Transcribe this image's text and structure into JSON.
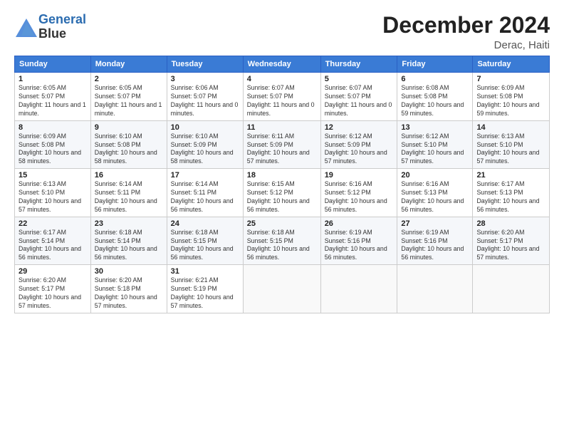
{
  "header": {
    "logo_line1": "General",
    "logo_line2": "Blue",
    "title": "December 2024",
    "subtitle": "Derac, Haiti"
  },
  "weekdays": [
    "Sunday",
    "Monday",
    "Tuesday",
    "Wednesday",
    "Thursday",
    "Friday",
    "Saturday"
  ],
  "weeks": [
    [
      {
        "day": "1",
        "sunrise": "Sunrise: 6:05 AM",
        "sunset": "Sunset: 5:07 PM",
        "daylight": "Daylight: 11 hours and 1 minute."
      },
      {
        "day": "2",
        "sunrise": "Sunrise: 6:05 AM",
        "sunset": "Sunset: 5:07 PM",
        "daylight": "Daylight: 11 hours and 1 minute."
      },
      {
        "day": "3",
        "sunrise": "Sunrise: 6:06 AM",
        "sunset": "Sunset: 5:07 PM",
        "daylight": "Daylight: 11 hours and 0 minutes."
      },
      {
        "day": "4",
        "sunrise": "Sunrise: 6:07 AM",
        "sunset": "Sunset: 5:07 PM",
        "daylight": "Daylight: 11 hours and 0 minutes."
      },
      {
        "day": "5",
        "sunrise": "Sunrise: 6:07 AM",
        "sunset": "Sunset: 5:07 PM",
        "daylight": "Daylight: 11 hours and 0 minutes."
      },
      {
        "day": "6",
        "sunrise": "Sunrise: 6:08 AM",
        "sunset": "Sunset: 5:08 PM",
        "daylight": "Daylight: 10 hours and 59 minutes."
      },
      {
        "day": "7",
        "sunrise": "Sunrise: 6:09 AM",
        "sunset": "Sunset: 5:08 PM",
        "daylight": "Daylight: 10 hours and 59 minutes."
      }
    ],
    [
      {
        "day": "8",
        "sunrise": "Sunrise: 6:09 AM",
        "sunset": "Sunset: 5:08 PM",
        "daylight": "Daylight: 10 hours and 58 minutes."
      },
      {
        "day": "9",
        "sunrise": "Sunrise: 6:10 AM",
        "sunset": "Sunset: 5:08 PM",
        "daylight": "Daylight: 10 hours and 58 minutes."
      },
      {
        "day": "10",
        "sunrise": "Sunrise: 6:10 AM",
        "sunset": "Sunset: 5:09 PM",
        "daylight": "Daylight: 10 hours and 58 minutes."
      },
      {
        "day": "11",
        "sunrise": "Sunrise: 6:11 AM",
        "sunset": "Sunset: 5:09 PM",
        "daylight": "Daylight: 10 hours and 57 minutes."
      },
      {
        "day": "12",
        "sunrise": "Sunrise: 6:12 AM",
        "sunset": "Sunset: 5:09 PM",
        "daylight": "Daylight: 10 hours and 57 minutes."
      },
      {
        "day": "13",
        "sunrise": "Sunrise: 6:12 AM",
        "sunset": "Sunset: 5:10 PM",
        "daylight": "Daylight: 10 hours and 57 minutes."
      },
      {
        "day": "14",
        "sunrise": "Sunrise: 6:13 AM",
        "sunset": "Sunset: 5:10 PM",
        "daylight": "Daylight: 10 hours and 57 minutes."
      }
    ],
    [
      {
        "day": "15",
        "sunrise": "Sunrise: 6:13 AM",
        "sunset": "Sunset: 5:10 PM",
        "daylight": "Daylight: 10 hours and 57 minutes."
      },
      {
        "day": "16",
        "sunrise": "Sunrise: 6:14 AM",
        "sunset": "Sunset: 5:11 PM",
        "daylight": "Daylight: 10 hours and 56 minutes."
      },
      {
        "day": "17",
        "sunrise": "Sunrise: 6:14 AM",
        "sunset": "Sunset: 5:11 PM",
        "daylight": "Daylight: 10 hours and 56 minutes."
      },
      {
        "day": "18",
        "sunrise": "Sunrise: 6:15 AM",
        "sunset": "Sunset: 5:12 PM",
        "daylight": "Daylight: 10 hours and 56 minutes."
      },
      {
        "day": "19",
        "sunrise": "Sunrise: 6:16 AM",
        "sunset": "Sunset: 5:12 PM",
        "daylight": "Daylight: 10 hours and 56 minutes."
      },
      {
        "day": "20",
        "sunrise": "Sunrise: 6:16 AM",
        "sunset": "Sunset: 5:13 PM",
        "daylight": "Daylight: 10 hours and 56 minutes."
      },
      {
        "day": "21",
        "sunrise": "Sunrise: 6:17 AM",
        "sunset": "Sunset: 5:13 PM",
        "daylight": "Daylight: 10 hours and 56 minutes."
      }
    ],
    [
      {
        "day": "22",
        "sunrise": "Sunrise: 6:17 AM",
        "sunset": "Sunset: 5:14 PM",
        "daylight": "Daylight: 10 hours and 56 minutes."
      },
      {
        "day": "23",
        "sunrise": "Sunrise: 6:18 AM",
        "sunset": "Sunset: 5:14 PM",
        "daylight": "Daylight: 10 hours and 56 minutes."
      },
      {
        "day": "24",
        "sunrise": "Sunrise: 6:18 AM",
        "sunset": "Sunset: 5:15 PM",
        "daylight": "Daylight: 10 hours and 56 minutes."
      },
      {
        "day": "25",
        "sunrise": "Sunrise: 6:18 AM",
        "sunset": "Sunset: 5:15 PM",
        "daylight": "Daylight: 10 hours and 56 minutes."
      },
      {
        "day": "26",
        "sunrise": "Sunrise: 6:19 AM",
        "sunset": "Sunset: 5:16 PM",
        "daylight": "Daylight: 10 hours and 56 minutes."
      },
      {
        "day": "27",
        "sunrise": "Sunrise: 6:19 AM",
        "sunset": "Sunset: 5:16 PM",
        "daylight": "Daylight: 10 hours and 56 minutes."
      },
      {
        "day": "28",
        "sunrise": "Sunrise: 6:20 AM",
        "sunset": "Sunset: 5:17 PM",
        "daylight": "Daylight: 10 hours and 57 minutes."
      }
    ],
    [
      {
        "day": "29",
        "sunrise": "Sunrise: 6:20 AM",
        "sunset": "Sunset: 5:17 PM",
        "daylight": "Daylight: 10 hours and 57 minutes."
      },
      {
        "day": "30",
        "sunrise": "Sunrise: 6:20 AM",
        "sunset": "Sunset: 5:18 PM",
        "daylight": "Daylight: 10 hours and 57 minutes."
      },
      {
        "day": "31",
        "sunrise": "Sunrise: 6:21 AM",
        "sunset": "Sunset: 5:19 PM",
        "daylight": "Daylight: 10 hours and 57 minutes."
      },
      null,
      null,
      null,
      null
    ]
  ]
}
